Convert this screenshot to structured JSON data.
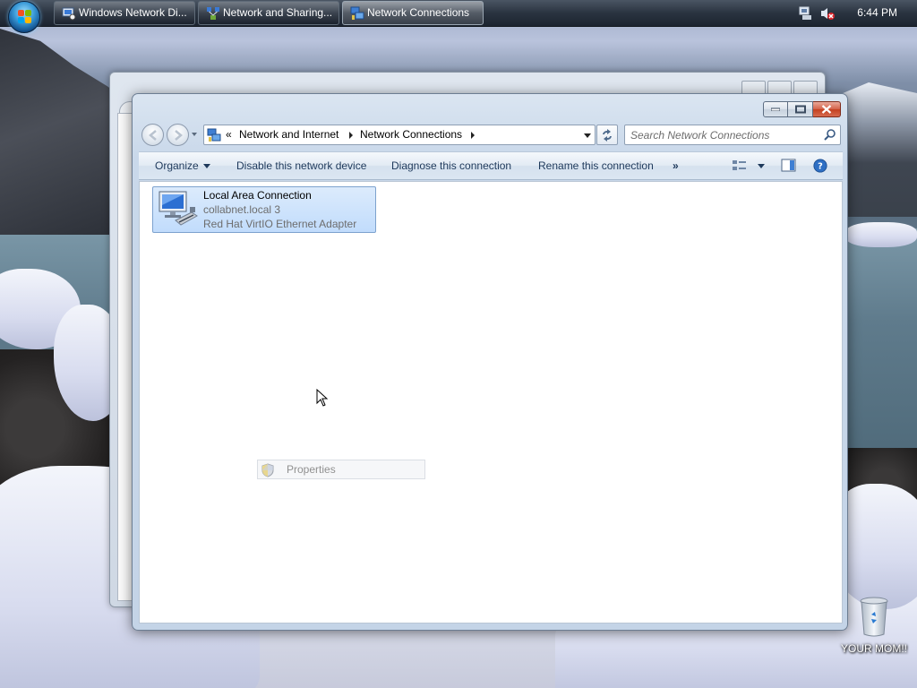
{
  "taskbar": {
    "buttons": [
      {
        "label": "Windows Network Di...",
        "active": false
      },
      {
        "label": "Network and Sharing...",
        "active": false
      },
      {
        "label": "Network Connections",
        "active": true
      }
    ],
    "clock": "6:44 PM",
    "tray_icons": [
      "network-disconnected-icon",
      "volume-muted-icon"
    ]
  },
  "explorer": {
    "breadcrumb": {
      "overflow": "«",
      "items": [
        "Network and Internet",
        "Network Connections"
      ]
    },
    "search_placeholder": "Search Network Connections",
    "toolbar": {
      "organize": "Organize",
      "disable": "Disable this network device",
      "diagnose": "Diagnose this connection",
      "rename": "Rename this connection",
      "more": "»"
    },
    "connection": {
      "name": "Local Area Connection",
      "network": "collabnet.local  3",
      "adapter": "Red Hat VirtIO Ethernet Adapter"
    },
    "context_menu": {
      "item": "Properties"
    }
  },
  "desktop": {
    "recycle_bin_label": "YOUR MOM!!"
  },
  "colors": {
    "toolbar_text": "#1e395b",
    "selection_bg": "#c1dcfc",
    "close_button": "#c4401f"
  }
}
